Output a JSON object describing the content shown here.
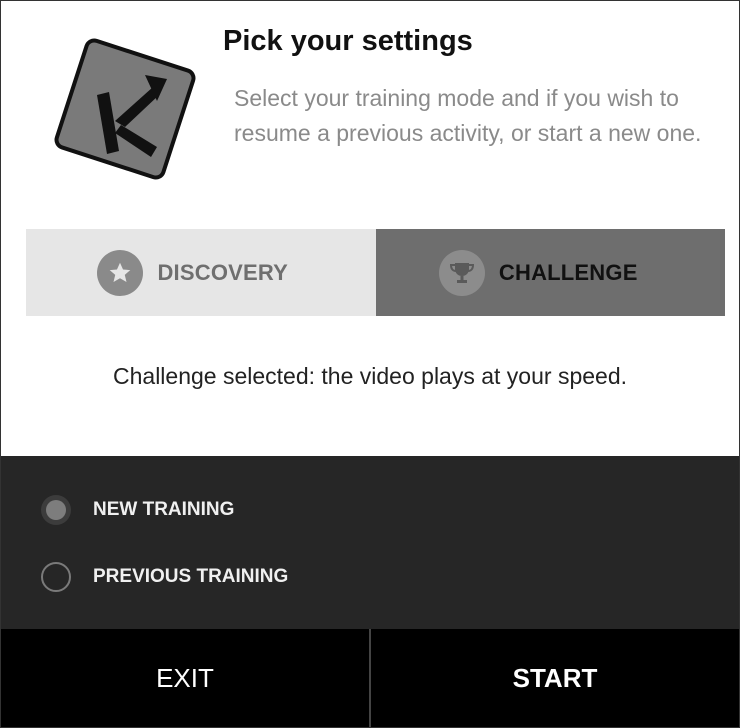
{
  "header": {
    "title": "Pick your settings",
    "subtitle": "Select your training mode and if you wish to resume a previous activity, or start a new one.",
    "logo_letter": "K"
  },
  "modes": {
    "selected": "challenge",
    "items": [
      {
        "id": "discovery",
        "label": "DISCOVERY",
        "icon": "star-icon"
      },
      {
        "id": "challenge",
        "label": "CHALLENGE",
        "icon": "trophy-icon"
      }
    ]
  },
  "status_text": "Challenge selected: the video plays at your speed.",
  "training": {
    "options": [
      {
        "label": "NEW TRAINING",
        "checked": true
      },
      {
        "label": "PREVIOUS TRAINING",
        "checked": false
      }
    ]
  },
  "footer": {
    "exit_label": "EXIT",
    "start_label": "START"
  },
  "colors": {
    "dark_panel": "#262626",
    "selected_mode": "#6e6e6e",
    "unselected_mode": "#e6e6e6"
  }
}
